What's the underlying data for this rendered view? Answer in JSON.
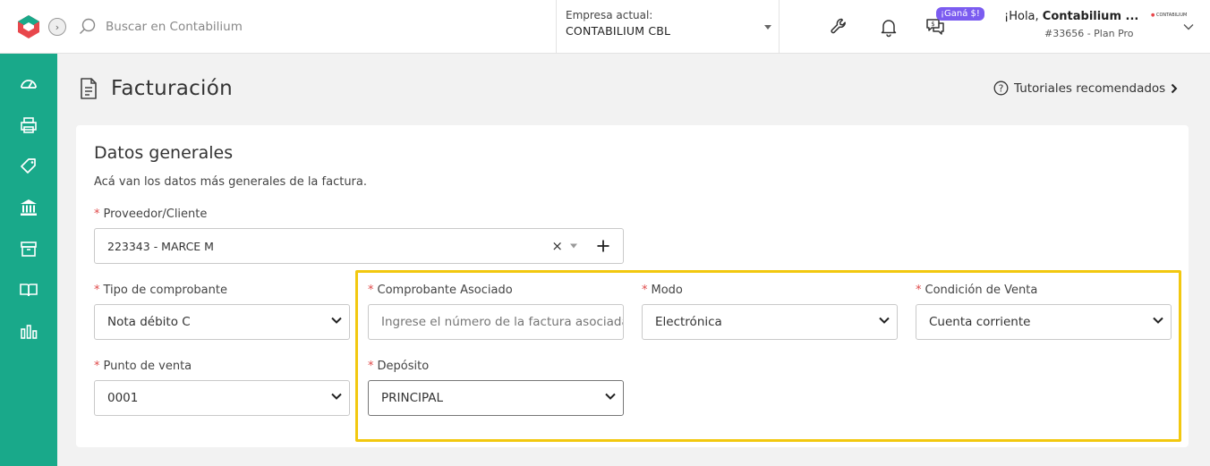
{
  "topbar": {
    "search_placeholder": "Buscar en Contabilium",
    "company_label": "Empresa actual:",
    "company_value": "CONTABILIUM CBL",
    "promo_badge": "¡Ganá $!",
    "user_greeting_prefix": "¡Hola, ",
    "user_name": "Contabilium ...",
    "user_plan": "#33656 - Plan Pro",
    "user_logo_text": "CONTABILIUM"
  },
  "sidebar": {
    "items": [
      "dashboard-icon",
      "printer-icon",
      "tag-icon",
      "bank-icon",
      "box-icon",
      "book-icon",
      "chart-icon"
    ]
  },
  "page": {
    "title": "Facturación",
    "tutorials_label": "Tutoriales recomendados"
  },
  "card": {
    "title": "Datos generales",
    "description": "Acá van los datos más generales de la factura.",
    "fields": {
      "cliente": {
        "label": "Proveedor/Cliente",
        "value": "223343 - MARCE M"
      },
      "tipo": {
        "label": "Tipo de comprobante",
        "value": "Nota débito C"
      },
      "asociado": {
        "label": "Comprobante Asociado",
        "placeholder": "Ingrese el número de la factura asociada"
      },
      "modo": {
        "label": "Modo",
        "value": "Electrónica"
      },
      "condicion": {
        "label": "Condición de Venta",
        "value": "Cuenta corriente"
      },
      "punto": {
        "label": "Punto de venta",
        "value": "0001"
      },
      "deposito": {
        "label": "Depósito",
        "value": "PRINCIPAL"
      }
    }
  },
  "colors": {
    "sidebar": "#19a98a",
    "highlight": "#f2c80f",
    "required": "#e04a4a",
    "promo": "#7b5cf0"
  }
}
